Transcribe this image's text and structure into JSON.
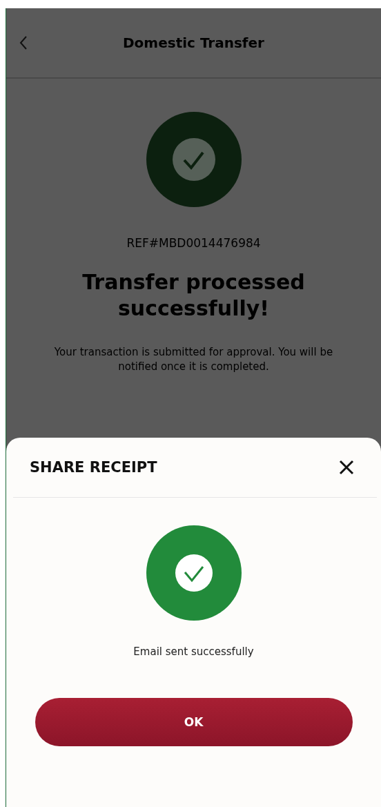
{
  "header": {
    "title": "Domestic Transfer"
  },
  "result": {
    "reference": "REF#MBD0014476984",
    "title": "Transfer processed successfully!",
    "message": "Your transaction is submitted for approval. You will be notified once it is completed."
  },
  "share_sheet": {
    "title": "SHARE RECEIPT",
    "status": "Email sent successfully",
    "button": "OK"
  }
}
